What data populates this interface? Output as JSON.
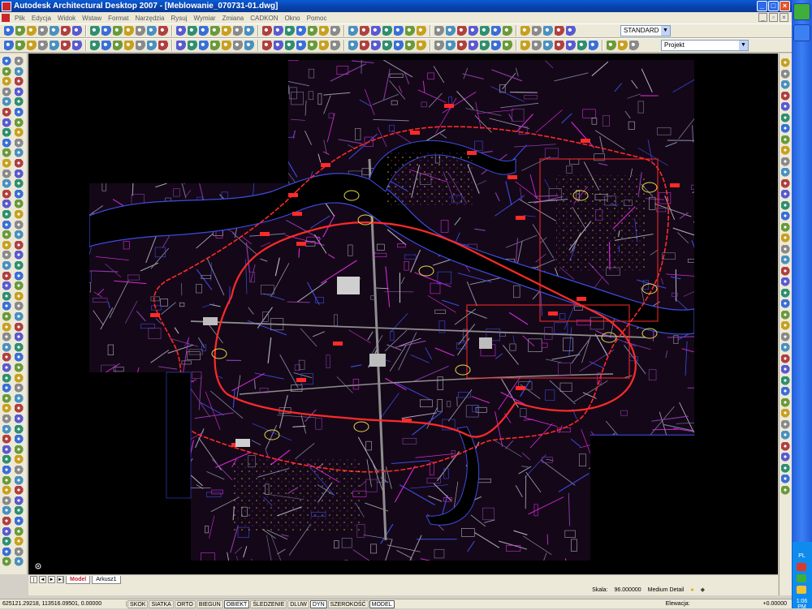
{
  "window": {
    "title": "Autodesk Architectural Desktop 2007 - [Meblowanie_070731-01.dwg]",
    "buttons": [
      "_",
      "□",
      "×"
    ]
  },
  "menu": {
    "items": [
      "Plik",
      "Edycja",
      "Widok",
      "Wstaw",
      "Format",
      "Narzędzia",
      "Rysuj",
      "Wymiar",
      "Zmiana",
      "CADKON",
      "Okno",
      "Pomoc"
    ]
  },
  "toolbar": {
    "style_combo": "STANDARD",
    "layer_combo": "Projekt"
  },
  "tabs": {
    "items": [
      "Model",
      "Arkusz1"
    ]
  },
  "cmd": {
    "scale_label": "Skala:",
    "scale_value": "96.000000",
    "detail_level": "Medium Detail"
  },
  "status": {
    "coords": "625121.29218, 113516.09501, 0.00000",
    "buttons": [
      "SKOK",
      "SIATKA",
      "ORTO",
      "BIEGUN",
      "OBIEKT",
      "ŚLEDZENIE",
      "DLUW",
      "DYN",
      "SZEROKOŚĆ",
      "MODEL"
    ],
    "elevation_label": "Elewacja:",
    "elevation_value": "+0.00000"
  },
  "tray": {
    "language": "PL",
    "clock": "1:06 PM"
  },
  "colors": {
    "title_bar": "#0842a8",
    "background_canvas": "#000000",
    "map_red": "#ff2a2a",
    "map_magenta": "#d62ad6",
    "map_yellow": "#e8d84a",
    "map_gray": "#9a9aa8",
    "map_blue": "#3c4ce0"
  }
}
